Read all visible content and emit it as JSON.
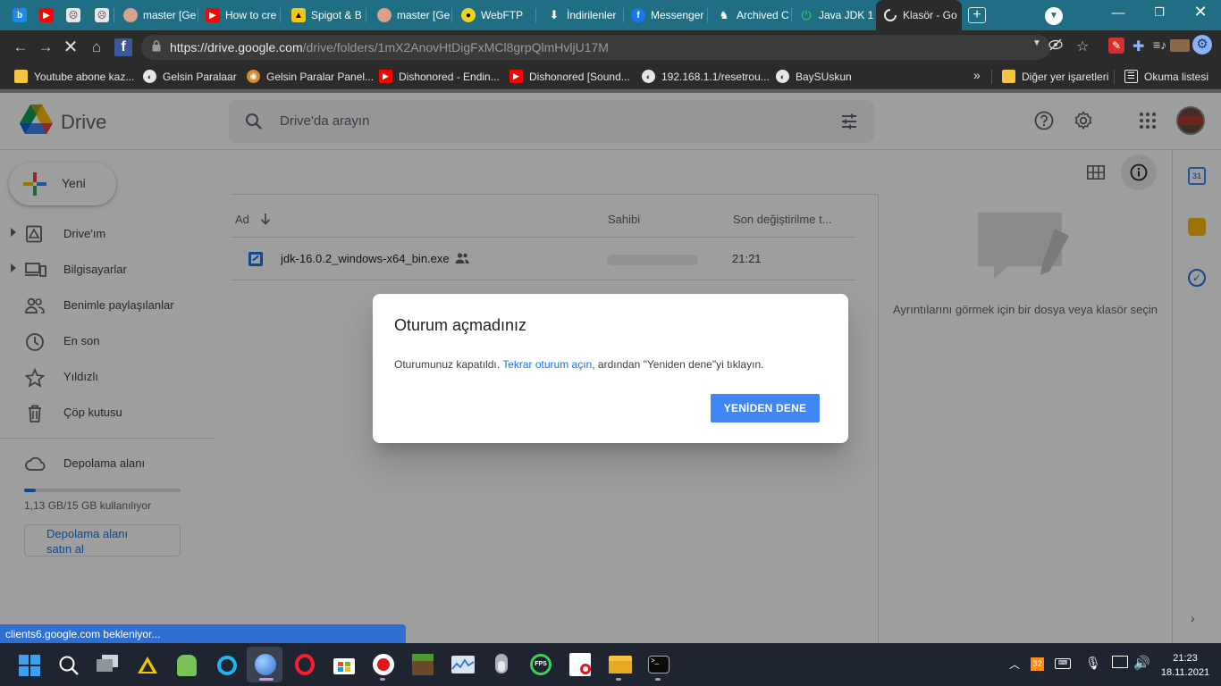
{
  "browser": {
    "tabs": [
      {
        "label": "",
        "icon": "bing-icon",
        "color": "#1e88e5"
      },
      {
        "label": "",
        "icon": "youtube-icon",
        "color": "#ff0000"
      },
      {
        "label": "",
        "icon": "mail-icon",
        "color": "#555555"
      },
      {
        "label": "",
        "icon": "mail-icon",
        "color": "#555555"
      },
      {
        "label": "master [Ge",
        "icon": "github-avatar-icon",
        "color": "#d9a08a"
      },
      {
        "label": "How to cre",
        "icon": "youtube-icon",
        "color": "#ff0000"
      },
      {
        "label": "Spigot & B",
        "icon": "spigot-icon",
        "color": "#f5c518"
      },
      {
        "label": "master [Ge",
        "icon": "github-avatar-icon",
        "color": "#d9a08a"
      },
      {
        "label": "WebFTP",
        "icon": "webftp-icon",
        "color": "#f2d21b"
      },
      {
        "label": "İndirilenler",
        "icon": "download-icon",
        "color": "#1f6e84"
      },
      {
        "label": "Messenger",
        "icon": "facebook-icon",
        "color": "#1877f2"
      },
      {
        "label": "Archived C",
        "icon": "archive-icon",
        "color": "#444444"
      },
      {
        "label": "Java JDK 1(",
        "icon": "power-icon",
        "color": "#2e9d46"
      },
      {
        "label": "Klasör - Go",
        "icon": "loading-icon",
        "color": "#2b2b2b"
      }
    ],
    "address": {
      "host": "https://drive.google.com",
      "path": "/drive/folders/1mX2AnovHtDigFxMCl8grpQlmHvljU17M"
    },
    "bookmarks": [
      {
        "label": "Youtube abone kaz...",
        "icon": "folder-icon",
        "color": "#f4c542"
      },
      {
        "label": "Gelsin Paralaar",
        "icon": "globe-icon",
        "color": "#2b2b2b"
      },
      {
        "label": "Gelsin Paralar Panel...",
        "icon": "owl-icon",
        "color": "#d68a2e"
      },
      {
        "label": "Dishonored - Endin...",
        "icon": "youtube-icon",
        "color": "#ff0000"
      },
      {
        "label": "Dishonored [Sound...",
        "icon": "youtube-icon",
        "color": "#ff0000"
      },
      {
        "label": "192.168.1.1/resetrou...",
        "icon": "globe-icon",
        "color": "#2b2b2b"
      },
      {
        "label": "BaySUskun",
        "icon": "globe-icon",
        "color": "#2b2b2b"
      }
    ],
    "bookmarks_more": "»",
    "other_bookmarks": "Diğer yer işaretleri",
    "reading_list": "Okuma listesi"
  },
  "drive": {
    "brand": "Drive",
    "search_placeholder": "Drive'da arayın",
    "new_button": "Yeni",
    "nav": [
      {
        "label": "Drive'ım",
        "icon": "my-drive-icon",
        "expandable": true
      },
      {
        "label": "Bilgisayarlar",
        "icon": "computers-icon",
        "expandable": true
      },
      {
        "label": "Benimle paylaşılanlar",
        "icon": "shared-icon",
        "expandable": false
      },
      {
        "label": "En son",
        "icon": "clock-icon",
        "expandable": false
      },
      {
        "label": "Yıldızlı",
        "icon": "star-icon",
        "expandable": false
      },
      {
        "label": "Çöp kutusu",
        "icon": "trash-icon",
        "expandable": false
      }
    ],
    "storage": {
      "label": "Depolama alanı",
      "usage": "1,13 GB/15 GB kullanılıyor",
      "used_fraction": 0.075,
      "buy_line1": "Depolama alanı",
      "buy_line2": "satın al"
    },
    "columns": {
      "name": "Ad",
      "owner": "Sahibi",
      "modified": "Son değiştirilme t..."
    },
    "files": [
      {
        "name": "jdk-16.0.2_windows-x64_bin.exe",
        "shared": true,
        "owner": "",
        "modified": "21:21"
      }
    ],
    "details_hint": "Ayrıntılarını görmek için bir dosya veya klasör seçin",
    "accent": "#1a73e8"
  },
  "dialog": {
    "title": "Oturum açmadınız",
    "message_before": "Oturumunuz kapatıldı.",
    "message_link": "Tekrar oturum açın",
    "message_after": ", ardından \"Yeniden dene\"yi tıklayın.",
    "button": "YENİDEN DENE"
  },
  "status_bar": "clients6.google.com bekleniyor...",
  "taskbar": {
    "tray_badge": "32",
    "time": "21:23",
    "date": "18.11.2021"
  }
}
